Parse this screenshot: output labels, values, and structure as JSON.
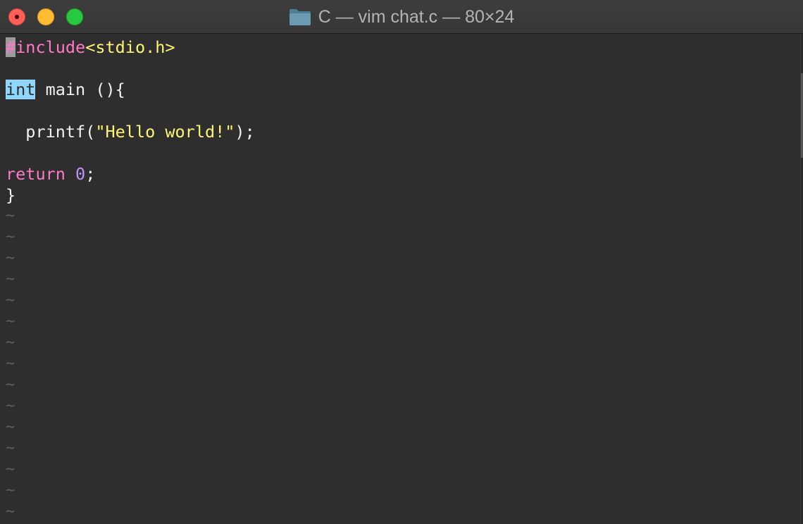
{
  "window": {
    "title": "C — vim chat.c — 80×24",
    "folder_icon": "folder-icon",
    "buttons": {
      "close": "close-button",
      "minimize": "minimize-button",
      "maximize": "maximize-button"
    }
  },
  "code": {
    "line1": {
      "hash": "#",
      "directive": "include",
      "header": "<stdio.h>"
    },
    "line3": {
      "type": "int",
      "rest": " main (){"
    },
    "line5": {
      "indent": "  ",
      "func": "printf(",
      "string": "\"Hello world!\"",
      "end": ");"
    },
    "line7": {
      "keyword": "return",
      "space": " ",
      "number": "0",
      "end": ";"
    },
    "line8": {
      "brace": "}"
    }
  },
  "empty_line_marker": "~",
  "colors": {
    "background": "#2e2e2e",
    "preprocessor": "#ff79c6",
    "string": "#fff573",
    "keyword": "#ff79c6",
    "number": "#bd93f9",
    "type_highlight": "#8fd7ff",
    "tilde": "#5e5e5e"
  }
}
